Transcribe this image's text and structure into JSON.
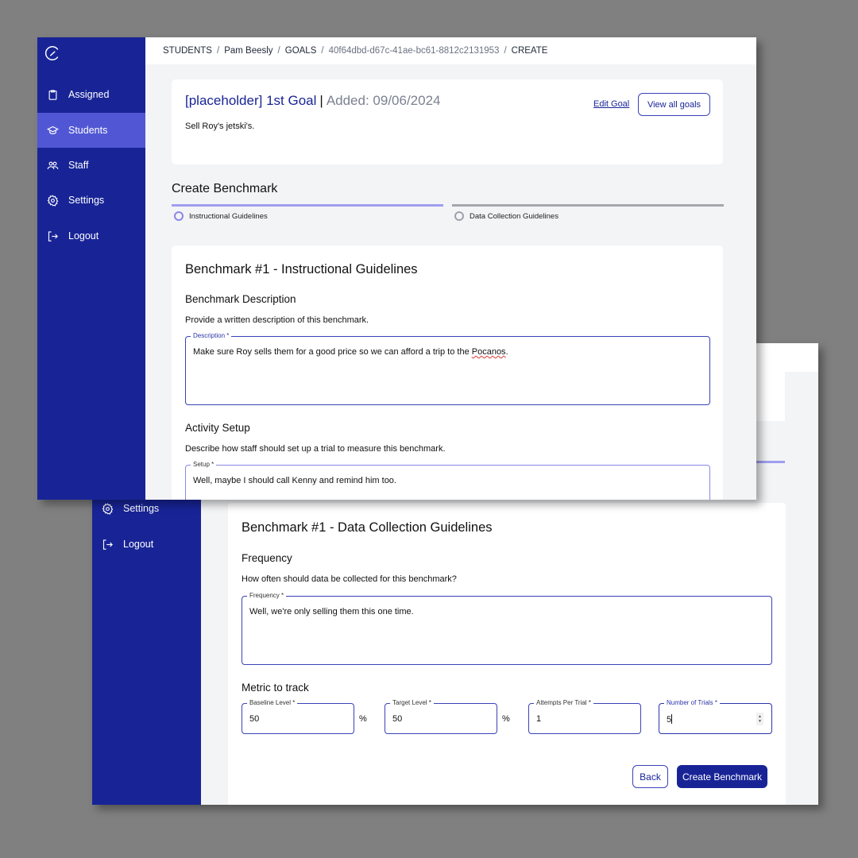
{
  "app": {
    "logo_icon": "gauge-icon"
  },
  "sidebar": {
    "items": [
      {
        "label": "Assigned",
        "icon": "clipboard-icon",
        "active": false
      },
      {
        "label": "Students",
        "icon": "graduation-cap-icon",
        "active": true
      },
      {
        "label": "Staff",
        "icon": "users-icon",
        "active": false
      },
      {
        "label": "Settings",
        "icon": "gear-icon",
        "active": false
      },
      {
        "label": "Logout",
        "icon": "logout-icon",
        "active": false
      }
    ]
  },
  "breadcrumb": {
    "items": [
      "STUDENTS",
      "Pam Beesly",
      "GOALS",
      "40f64dbd-d67c-41ae-bc61-8812c2131953",
      "CREATE"
    ],
    "separator": "/"
  },
  "goal": {
    "title": "[placeholder] 1st Goal",
    "divider": "|",
    "added": "Added: 09/06/2024",
    "description": "Sell Roy's jetski's.",
    "edit_label": "Edit Goal",
    "view_all_label": "View all goals"
  },
  "create_benchmark": {
    "title": "Create Benchmark",
    "steps": [
      {
        "label": "Instructional Guidelines",
        "state": "active"
      },
      {
        "label": "Data Collection Guidelines",
        "state": "inactive"
      }
    ]
  },
  "instructional": {
    "title": "Benchmark #1 - Instructional Guidelines",
    "description_section": {
      "title": "Benchmark Description",
      "help": "Provide a written description of this benchmark.",
      "field_label": "Description *",
      "value_before": "Make sure Roy sells them for a good price so we can afford a trip to the ",
      "value_misspelled": "Pocanos",
      "value_after": "."
    },
    "setup_section": {
      "title": "Activity Setup",
      "help": "Describe how staff should set up a trial to measure this benchmark.",
      "field_label": "Setup *",
      "value": "Well, maybe I should call Kenny and remind him too."
    }
  },
  "data_collection": {
    "title": "Benchmark #1 - Data Collection Guidelines",
    "frequency_section": {
      "title": "Frequency",
      "help": "How often should data be collected for this benchmark?",
      "field_label": "Frequency *",
      "value": "Well, we're only selling them this one time."
    },
    "metric_section": {
      "title": "Metric to track",
      "fields": [
        {
          "label": "Baseline Level *",
          "value": "50",
          "suffix": "%"
        },
        {
          "label": "Target Level *",
          "value": "50",
          "suffix": "%"
        },
        {
          "label": "Attempts Per Trial *",
          "value": "1"
        },
        {
          "label": "Number of Trials *",
          "value": "5",
          "focused": true
        }
      ]
    },
    "back_label": "Back",
    "submit_label": "Create Benchmark"
  }
}
